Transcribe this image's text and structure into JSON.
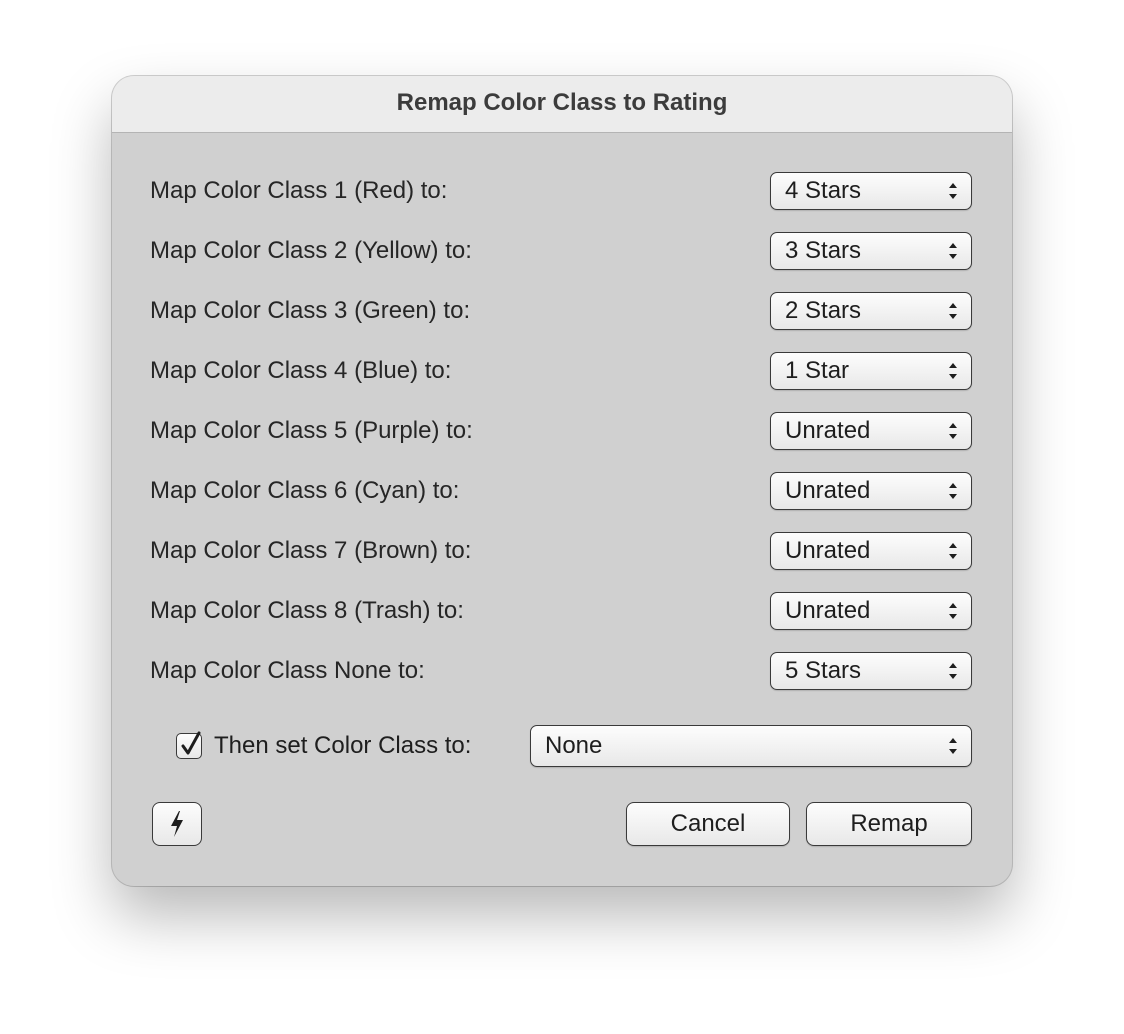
{
  "dialog": {
    "title": "Remap Color Class to Rating"
  },
  "mappings": [
    {
      "label": "Map Color Class 1 (Red) to:",
      "value": "4 Stars"
    },
    {
      "label": "Map Color Class 2 (Yellow) to:",
      "value": "3 Stars"
    },
    {
      "label": "Map Color Class 3 (Green) to:",
      "value": "2 Stars"
    },
    {
      "label": "Map Color Class 4 (Blue) to:",
      "value": "1 Star"
    },
    {
      "label": "Map Color Class 5 (Purple) to:",
      "value": "Unrated"
    },
    {
      "label": "Map Color Class 6 (Cyan) to:",
      "value": "Unrated"
    },
    {
      "label": "Map Color Class 7 (Brown) to:",
      "value": "Unrated"
    },
    {
      "label": "Map Color Class 8 (Trash) to:",
      "value": "Unrated"
    },
    {
      "label": "Map Color Class None to:",
      "value": "5 Stars"
    }
  ],
  "then_set": {
    "checked": true,
    "label": "Then set Color Class to:",
    "value": "None"
  },
  "buttons": {
    "action_icon": "lightning-bolt-icon",
    "cancel": "Cancel",
    "remap": "Remap"
  }
}
